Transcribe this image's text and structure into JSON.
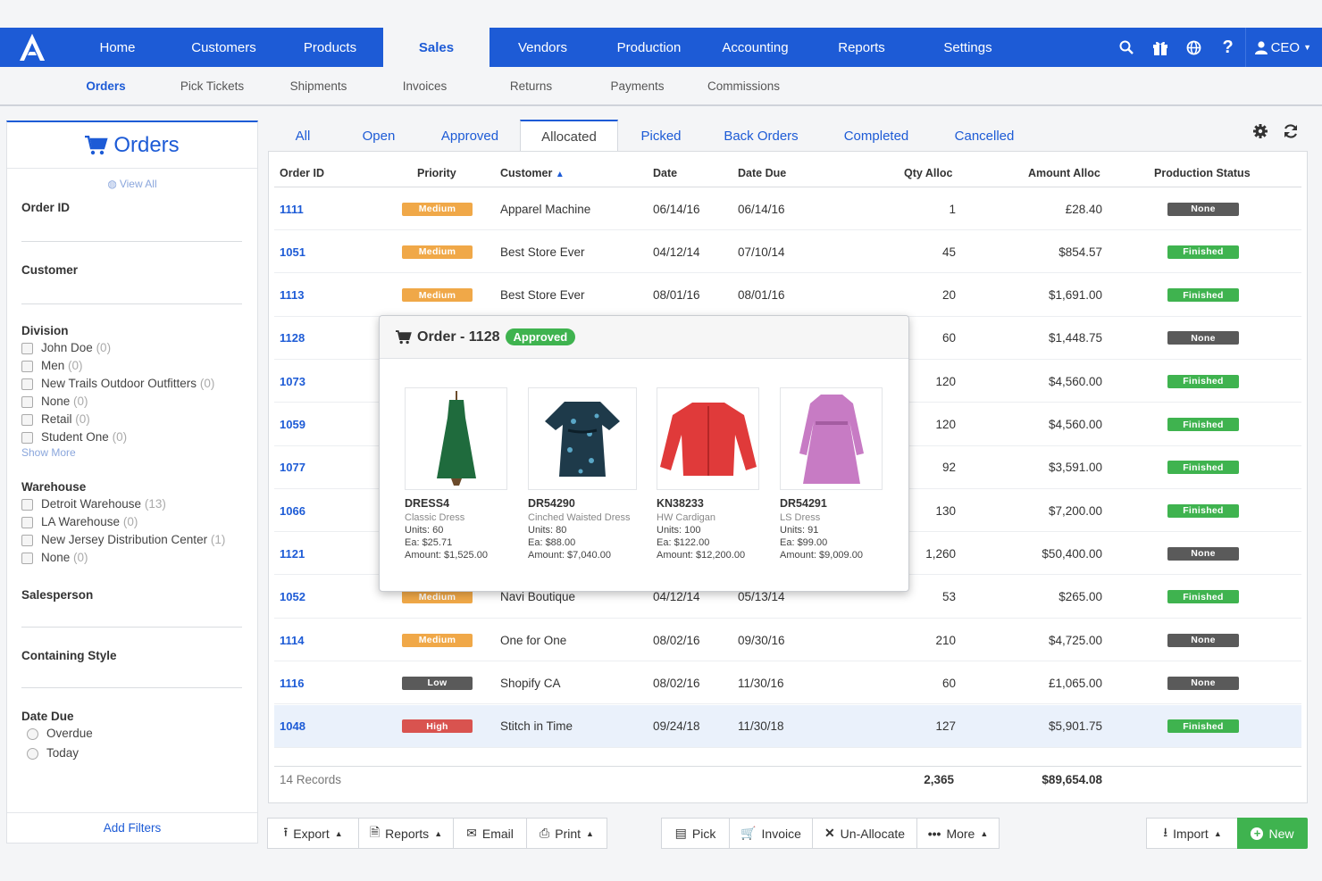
{
  "nav": {
    "items": [
      "Home",
      "Customers",
      "Products",
      "Sales",
      "Vendors",
      "Production",
      "Accounting",
      "Reports",
      "Settings"
    ],
    "active": "Sales",
    "user": "CEO",
    "icons": [
      "search-icon",
      "gift-icon",
      "globe-icon",
      "help-icon"
    ]
  },
  "subnav": {
    "items": [
      "Orders",
      "Pick Tickets",
      "Shipments",
      "Invoices",
      "Returns",
      "Payments",
      "Commissions"
    ],
    "active": "Orders"
  },
  "filters": {
    "title": "Orders",
    "view_all": "View All",
    "order_id": "Order ID",
    "customer": "Customer",
    "division": {
      "label": "Division",
      "options": [
        {
          "name": "John Doe",
          "count": "(0)"
        },
        {
          "name": "Men",
          "count": "(0)"
        },
        {
          "name": "New Trails Outdoor Outfitters",
          "count": "(0)"
        },
        {
          "name": "None",
          "count": "(0)"
        },
        {
          "name": "Retail",
          "count": "(0)"
        },
        {
          "name": "Student One",
          "count": "(0)"
        }
      ],
      "show_more": "Show More"
    },
    "warehouse": {
      "label": "Warehouse",
      "options": [
        {
          "name": "Detroit Warehouse",
          "count": "(13)"
        },
        {
          "name": "LA Warehouse",
          "count": "(0)"
        },
        {
          "name": "New Jersey Distribution Center",
          "count": "(1)"
        },
        {
          "name": "None",
          "count": "(0)"
        }
      ]
    },
    "salesperson": "Salesperson",
    "containing_style": "Containing Style",
    "date_due": {
      "label": "Date Due",
      "options": [
        "Overdue",
        "Today"
      ]
    },
    "add_filters": "Add Filters"
  },
  "tabs": {
    "items": [
      "All",
      "Open",
      "Approved",
      "Allocated",
      "Picked",
      "Back Orders",
      "Completed",
      "Cancelled"
    ],
    "active": "Allocated"
  },
  "table": {
    "headers": {
      "order_id": "Order ID",
      "priority": "Priority",
      "customer": "Customer",
      "date": "Date",
      "date_due": "Date Due",
      "qty_alloc": "Qty Alloc",
      "amount_alloc": "Amount Alloc",
      "production_status": "Production Status"
    },
    "rows": [
      {
        "id": "1111",
        "priority": "Medium",
        "customer": "Apparel Machine",
        "date": "06/14/16",
        "due": "06/14/16",
        "qty": "1",
        "amount": "£28.40",
        "status": "None"
      },
      {
        "id": "1051",
        "priority": "Medium",
        "customer": "Best Store Ever",
        "date": "04/12/14",
        "due": "07/10/14",
        "qty": "45",
        "amount": "$854.57",
        "status": "Finished"
      },
      {
        "id": "1113",
        "priority": "Medium",
        "customer": "Best Store Ever",
        "date": "08/01/16",
        "due": "08/01/16",
        "qty": "20",
        "amount": "$1,691.00",
        "status": "Finished"
      },
      {
        "id": "1128",
        "priority": "",
        "customer": "",
        "date": "",
        "due": "",
        "qty": "60",
        "amount": "$1,448.75",
        "status": "None"
      },
      {
        "id": "1073",
        "priority": "",
        "customer": "",
        "date": "",
        "due": "",
        "qty": "120",
        "amount": "$4,560.00",
        "status": "Finished"
      },
      {
        "id": "1059",
        "priority": "",
        "customer": "",
        "date": "",
        "due": "",
        "qty": "120",
        "amount": "$4,560.00",
        "status": "Finished"
      },
      {
        "id": "1077",
        "priority": "",
        "customer": "",
        "date": "",
        "due": "",
        "qty": "92",
        "amount": "$3,591.00",
        "status": "Finished"
      },
      {
        "id": "1066",
        "priority": "",
        "customer": "",
        "date": "",
        "due": "",
        "qty": "130",
        "amount": "$7,200.00",
        "status": "Finished"
      },
      {
        "id": "1121",
        "priority": "",
        "customer": "",
        "date": "",
        "due": "",
        "qty": "1,260",
        "amount": "$50,400.00",
        "status": "None"
      },
      {
        "id": "1052",
        "priority": "Medium",
        "customer": "Navi Boutique",
        "date": "04/12/14",
        "due": "05/13/14",
        "qty": "53",
        "amount": "$265.00",
        "status": "Finished"
      },
      {
        "id": "1114",
        "priority": "Medium",
        "customer": "One for One",
        "date": "08/02/16",
        "due": "09/30/16",
        "qty": "210",
        "amount": "$4,725.00",
        "status": "None"
      },
      {
        "id": "1116",
        "priority": "Low",
        "customer": "Shopify CA",
        "date": "08/02/16",
        "due": "11/30/16",
        "qty": "60",
        "amount": "£1,065.00",
        "status": "None"
      },
      {
        "id": "1048",
        "priority": "High",
        "customer": "Stitch in Time",
        "date": "09/24/18",
        "due": "11/30/18",
        "qty": "127",
        "amount": "$5,901.75",
        "status": "Finished"
      }
    ],
    "records": "14 Records",
    "total_qty": "2,365",
    "total_amount": "$89,654.08"
  },
  "colors": {
    "primary": "#1d5bd6",
    "medium": "#f0a848",
    "low": "#5a5a5a",
    "high": "#d9534f",
    "finished": "#3fb34f",
    "none": "#5a5a5a"
  },
  "popup": {
    "title": "Order - 1128",
    "badge": "Approved",
    "products": [
      {
        "sku": "DRESS4",
        "name": "Classic Dress",
        "units": "Units: 60",
        "each": "Ea: $25.71",
        "amount": "Amount: $1,525.00",
        "color": "#1f6b3d"
      },
      {
        "sku": "DR54290",
        "name": "Cinched Waisted Dress",
        "units": "Units: 80",
        "each": "Ea: $88.00",
        "amount": "Amount: $7,040.00",
        "color": "#1e3a4a"
      },
      {
        "sku": "KN38233",
        "name": "HW Cardigan",
        "units": "Units: 100",
        "each": "Ea: $122.00",
        "amount": "Amount: $12,200.00",
        "color": "#e03a3a"
      },
      {
        "sku": "DR54291",
        "name": "LS Dress",
        "units": "Units: 91",
        "each": "Ea: $99.00",
        "amount": "Amount: $9,009.00",
        "color": "#c77bc4"
      }
    ]
  },
  "toolbar": {
    "left": [
      "Export",
      "Reports",
      "Email",
      "Print"
    ],
    "middle": [
      "Pick",
      "Invoice",
      "Un-Allocate",
      "More"
    ],
    "import": "Import",
    "new": "New"
  }
}
